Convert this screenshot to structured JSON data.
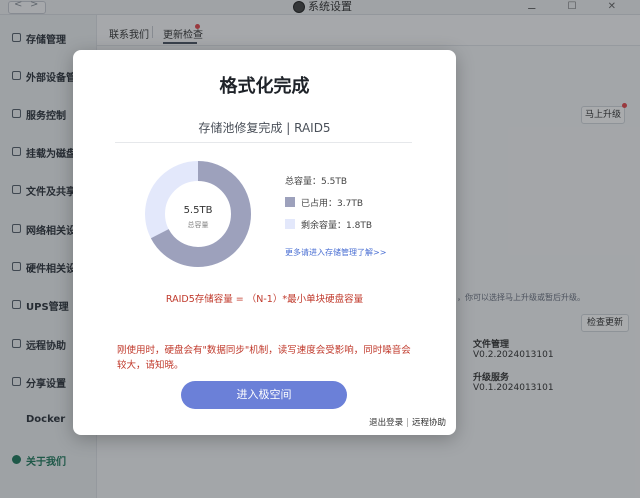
{
  "window": {
    "title": "系统设置",
    "controls": "⚊ ☐ ✕"
  },
  "sidebar": {
    "items": [
      {
        "label": "存储管理"
      },
      {
        "label": "外部设备管理"
      },
      {
        "label": "服务控制"
      },
      {
        "label": "挂载为磁盘"
      },
      {
        "label": "文件及共享"
      },
      {
        "label": "网络相关设置"
      },
      {
        "label": "硬件相关设置"
      },
      {
        "label": "UPS管理"
      },
      {
        "label": "远程协助"
      },
      {
        "label": "分享设置"
      },
      {
        "label": "Docker"
      },
      {
        "label": "关于我们"
      }
    ]
  },
  "tabs": {
    "contact": "联系我们",
    "update": "更新检查"
  },
  "background": {
    "upgrade_now": "马上升级",
    "note": "，你可以选择马上升级或暂后升级。",
    "check_update": "检查更新",
    "services": [
      {
        "name": "文件管理",
        "version": "V0.2.2024013101"
      },
      {
        "name": "升级服务",
        "version": "V0.1.2024013101"
      }
    ],
    "left_versions": [
      "V0.2.2024013101",
      "V0.1.2024013101"
    ]
  },
  "modal": {
    "title": "格式化完成",
    "subtitle": "存储池修复完成 | RAID5",
    "donut_total": "5.5TB",
    "donut_caption": "总容量",
    "total_label": "总容量：",
    "total_value": "5.5TB",
    "used_label": "已占用：",
    "used_value": "3.7TB",
    "free_label": "剩余容量：",
    "free_value": "1.8TB",
    "used_fraction": 0.673,
    "used_color": "#9da1bc",
    "free_color": "#e3e8fb",
    "more_link": "更多请进入存储管理了解>>",
    "formula": "RAID5存储容量 = （N-1）*最小单块硬盘容量",
    "warning": "刚使用时，硬盘会有\"数据同步\"机制，读写速度会受影响，同时噪音会较大，请知晓。",
    "enter_button": "进入极空间",
    "footer_logout": "退出登录",
    "footer_sep": "|",
    "footer_remote": "远程协助"
  }
}
